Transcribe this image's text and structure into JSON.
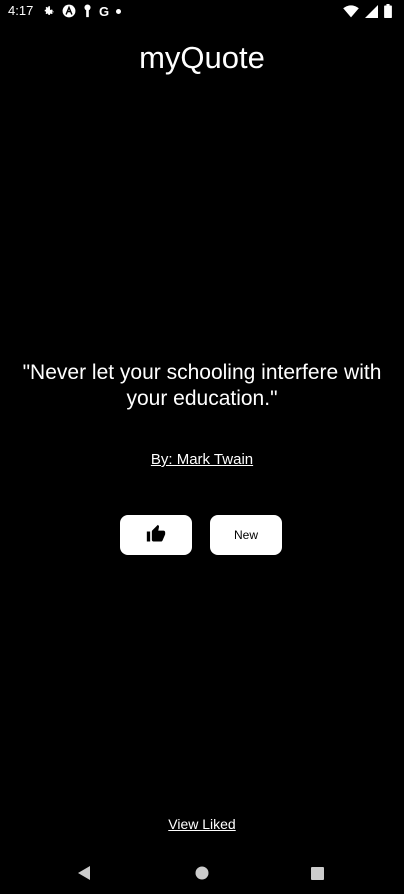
{
  "status_bar": {
    "time": "4:17",
    "left_icons": [
      "gear-icon",
      "a-badge-icon",
      "key-icon",
      "google-g-icon",
      "dot-icon"
    ],
    "right_icons": [
      "wifi-icon",
      "signal-icon",
      "battery-icon"
    ],
    "google_letter": "G"
  },
  "app": {
    "title": "myQuote"
  },
  "quote": {
    "text": "\"Never let your schooling interfere with your education.\"",
    "author": "By: Mark Twain"
  },
  "actions": {
    "like_icon": "thumbs-up-icon",
    "new_label": "New"
  },
  "footer": {
    "view_liked_label": "View Liked"
  },
  "nav": {
    "icons": [
      "back-icon",
      "home-icon",
      "recents-icon"
    ]
  },
  "colors": {
    "background": "#000000",
    "text": "#ffffff",
    "button_bg": "#ffffff"
  }
}
